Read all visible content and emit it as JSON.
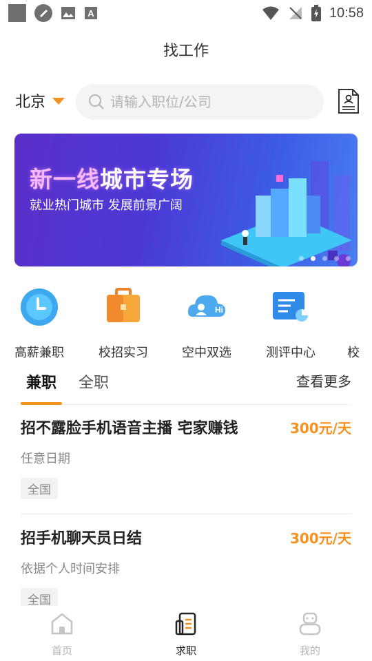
{
  "status_bar": {
    "time": "10:58"
  },
  "header": {
    "title": "找工作"
  },
  "search": {
    "city": "北京",
    "placeholder": "请输入职位/公司"
  },
  "banner": {
    "title_part1": "新一线",
    "title_part2": "城市专场",
    "subtitle": "就业热门城市  发展前景广阔"
  },
  "quick_entries": [
    {
      "label": "高薪兼职",
      "icon": "clock-icon"
    },
    {
      "label": "校招实习",
      "icon": "briefcase-icon"
    },
    {
      "label": "空中双选",
      "icon": "cloud-chat-icon"
    },
    {
      "label": "测评中心",
      "icon": "assessment-icon"
    },
    {
      "label": "校",
      "icon": "partial-icon"
    }
  ],
  "tabs": {
    "part_time": "兼职",
    "full_time": "全职",
    "more": "查看更多"
  },
  "jobs": [
    {
      "title": "招不露脸手机语音主播 宅家赚钱",
      "salary": "300元/天",
      "desc": "任意日期",
      "tag": "全国"
    },
    {
      "title": "招手机聊天员日结",
      "salary": "300元/天",
      "desc": "依据个人时间安排",
      "tag": "全国"
    }
  ],
  "bottom_nav": {
    "home": "首页",
    "jobs": "求职",
    "me": "我的"
  },
  "colors": {
    "accent": "#f6901e",
    "banner_start": "#5b2fc9",
    "banner_end": "#4a7ef0"
  }
}
